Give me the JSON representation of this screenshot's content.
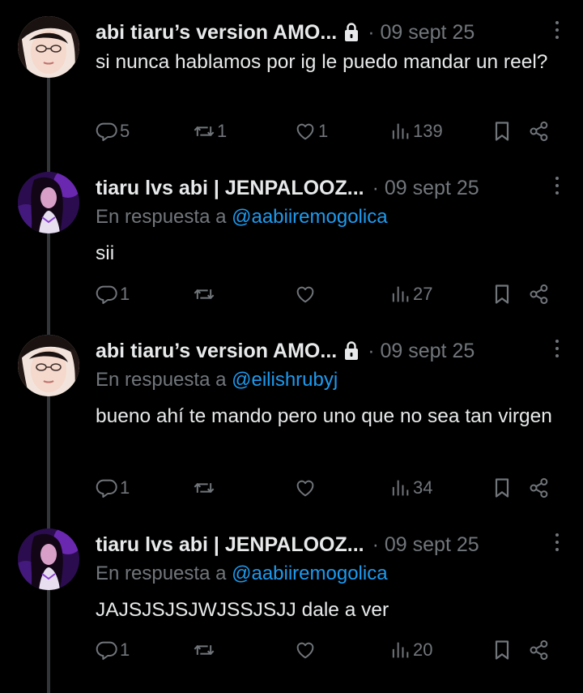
{
  "tweets": [
    {
      "name": "abi tiaru’s version AMO...",
      "locked": true,
      "meta": "· 09 sept 25",
      "reply_prefix": "",
      "reply_handle": "",
      "text": "si nunca hablamos por ig le puedo mandar un reel?",
      "replies": "5",
      "retweets": "1",
      "likes": "1",
      "views": "139",
      "avatar": "avatar-woman-glasses"
    },
    {
      "name": "tiaru lvs abi | JENPALOOZ...",
      "locked": false,
      "meta": "· 09 sept 25",
      "reply_prefix": "En respuesta a ",
      "reply_handle": "@aabiiremogolica",
      "text": "sii",
      "replies": "1",
      "retweets": "",
      "likes": "",
      "views": "27",
      "avatar": "avatar-purple-performer"
    },
    {
      "name": "abi tiaru’s version AMO...",
      "locked": true,
      "meta": "· 09 sept 25",
      "reply_prefix": "En respuesta a ",
      "reply_handle": "@eilishrubyj",
      "text": "bueno ahí te mando pero uno que no sea tan virgen",
      "replies": "1",
      "retweets": "",
      "likes": "",
      "views": "34",
      "avatar": "avatar-woman-glasses"
    },
    {
      "name": "tiaru lvs abi | JENPALOOZ...",
      "locked": false,
      "meta": "· 09 sept 25",
      "reply_prefix": "En respuesta a ",
      "reply_handle": "@aabiiremogolica",
      "text": "JAJSJSJSJWJSSJSJJ dale a ver",
      "replies": "1",
      "retweets": "",
      "likes": "",
      "views": "20",
      "avatar": "avatar-purple-performer"
    }
  ],
  "colors": {
    "background": "#000000",
    "text": "#e7e9ea",
    "muted": "#71767b",
    "link": "#1d9bf0",
    "thread_line": "#333639"
  },
  "icons": [
    "reply-icon",
    "retweet-icon",
    "like-icon",
    "views-icon",
    "bookmark-icon",
    "share-icon",
    "lock-icon",
    "more-icon"
  ]
}
